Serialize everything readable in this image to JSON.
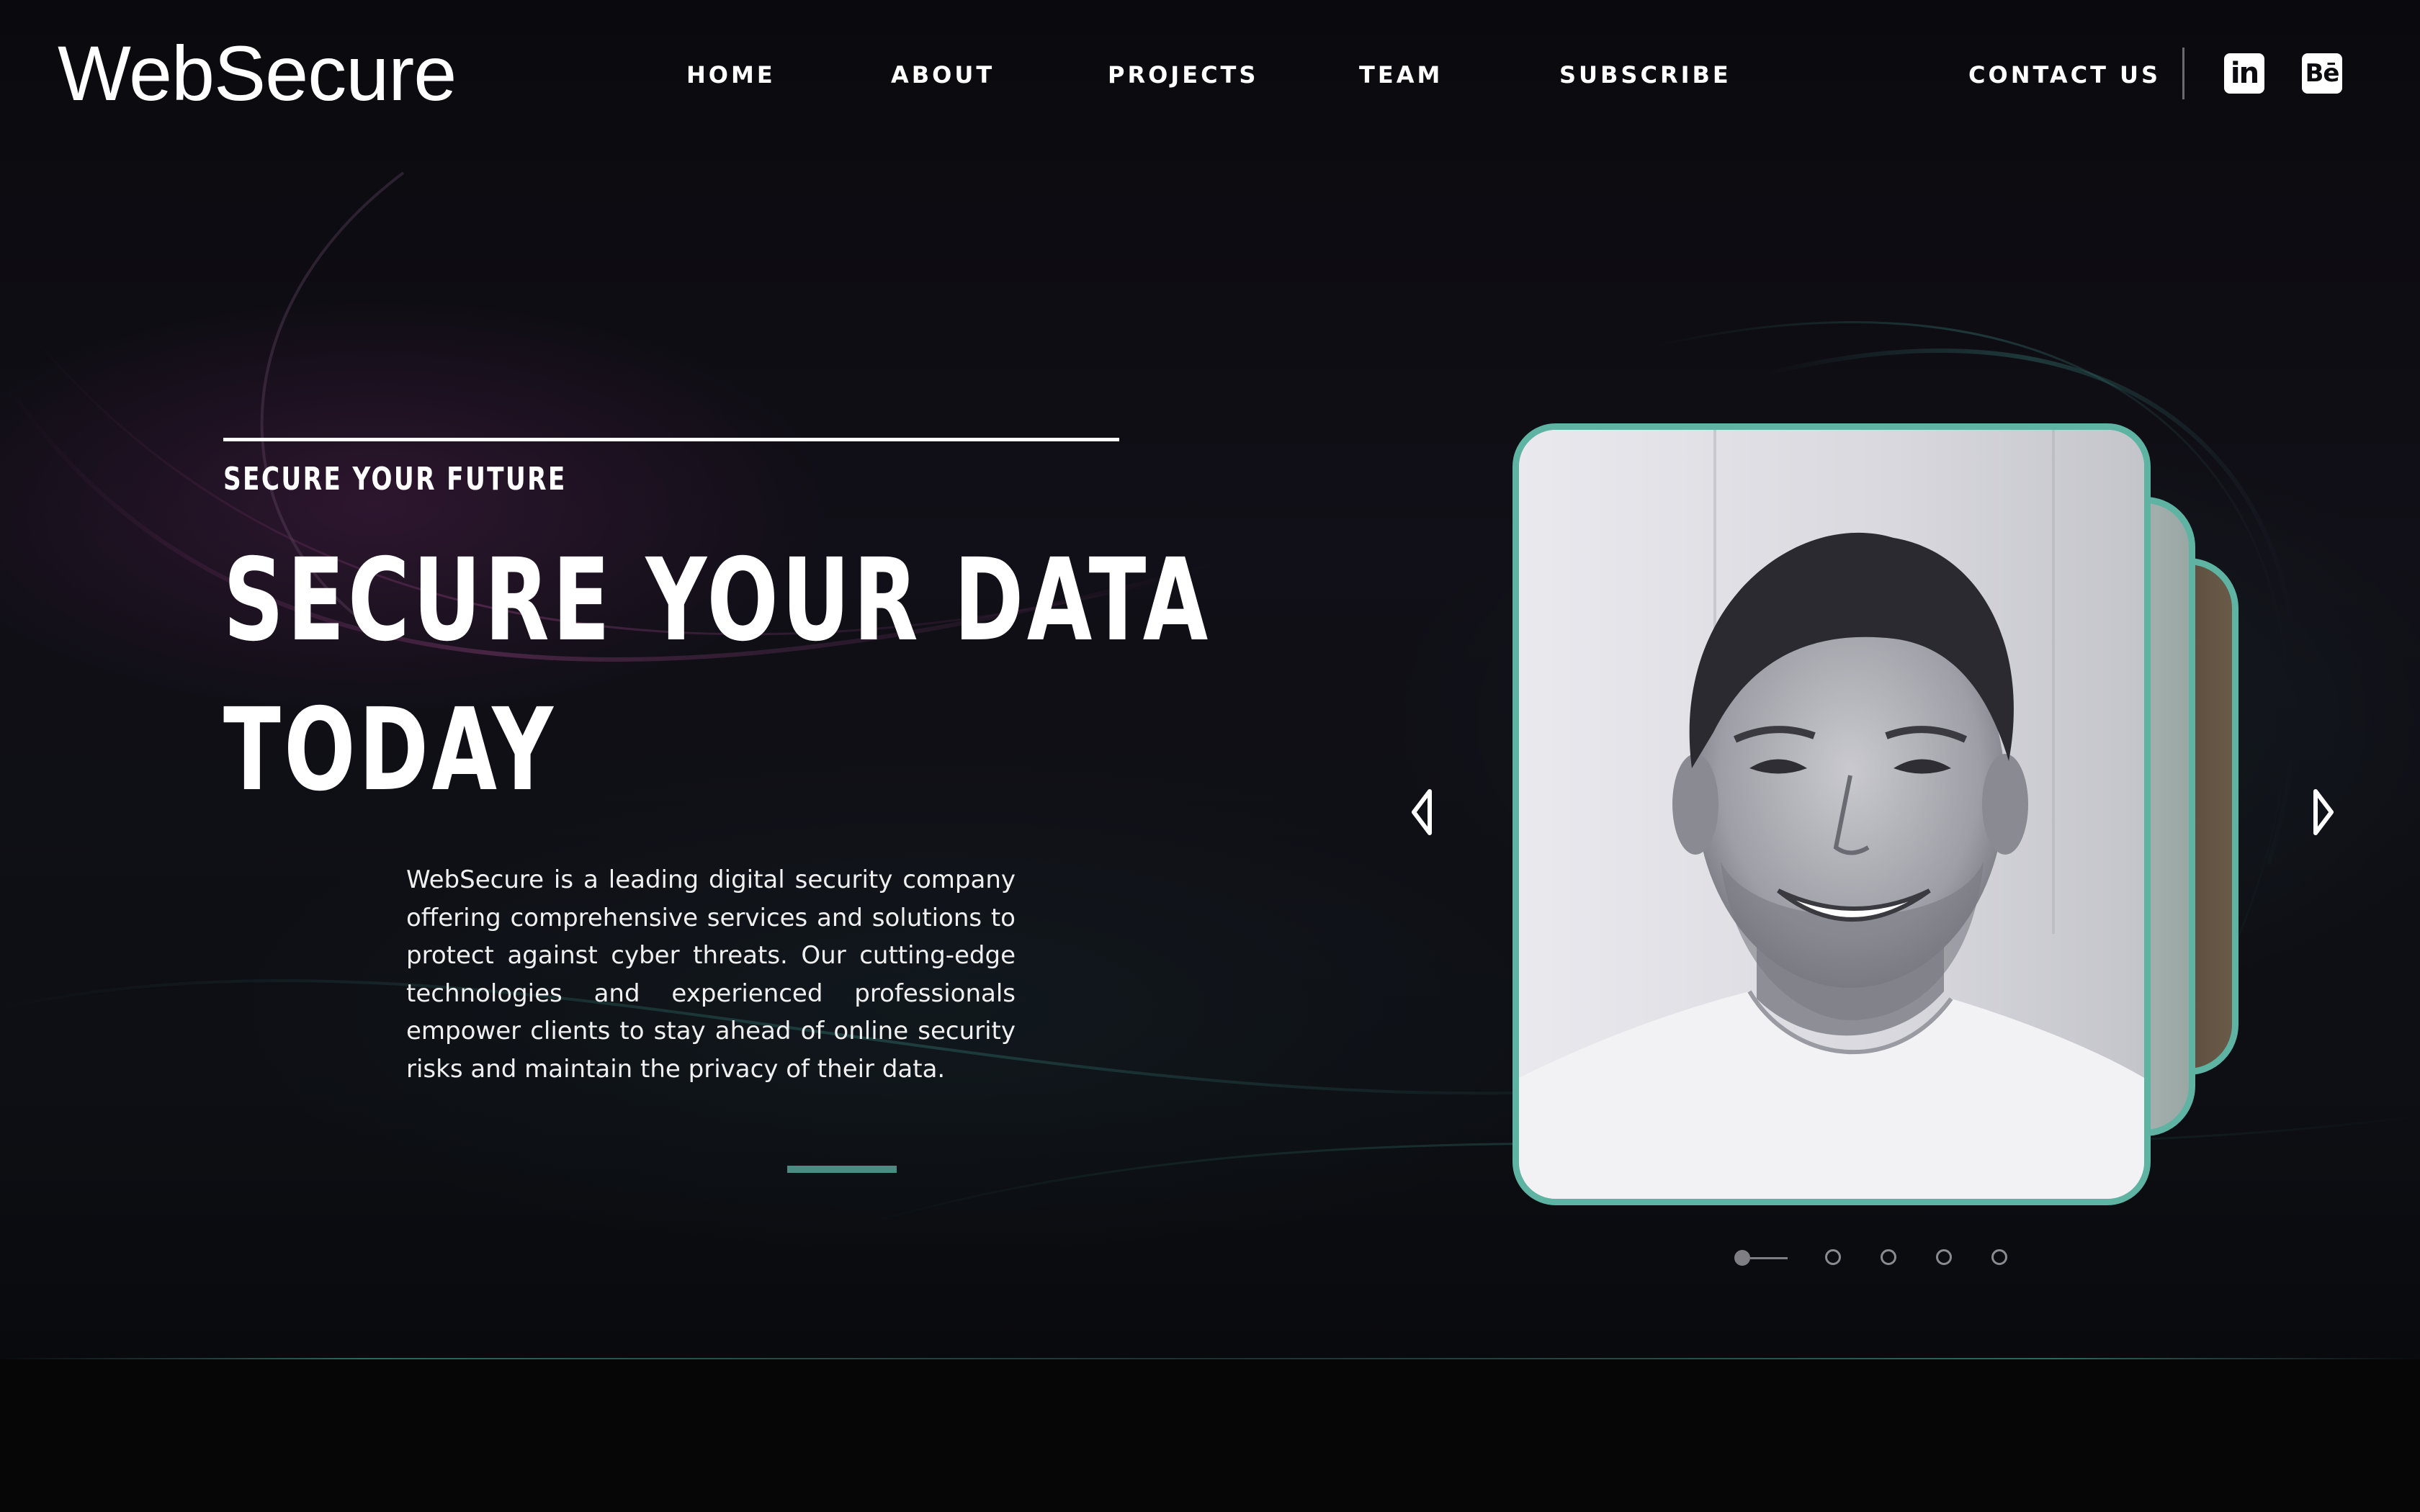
{
  "header": {
    "logo": "WebSecure",
    "nav": [
      {
        "label": "HOME"
      },
      {
        "label": "ABOUT"
      },
      {
        "label": "PROJECTS"
      },
      {
        "label": "TEAM"
      },
      {
        "label": "SUBSCRIBE"
      }
    ],
    "contact_label": "CONTACT US",
    "social": [
      {
        "icon": "linkedin-icon",
        "glyph": "in"
      },
      {
        "icon": "behance-icon",
        "glyph": "Bē"
      }
    ]
  },
  "hero": {
    "eyebrow": "SECURE YOUR FUTURE",
    "headline_line1": "SECURE YOUR DATA",
    "headline_line2": "TODAY",
    "description": "WebSecure is a leading digital security company offering comprehensive services and solutions to protect against cyber threats. Our cutting-edge technologies and experienced professionals empower clients to stay ahead of online security risks and maintain the privacy of their data."
  },
  "carousel": {
    "slide_count": 5,
    "active_index": 1,
    "accent_color": "#5fb3a3",
    "prev_icon": "chevron-left-icon",
    "next_icon": "chevron-right-icon"
  },
  "colors": {
    "background": "#0b0b10",
    "accent": "#5fb3a3",
    "accent_bar": "#4a8c82",
    "text": "#ffffff"
  }
}
